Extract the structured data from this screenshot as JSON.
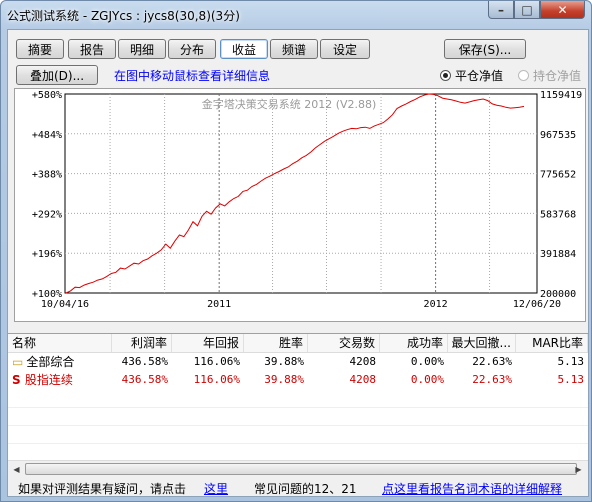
{
  "window": {
    "title": "公式测试系统 - ZGJYcs : jycs8(30,8)(3分)",
    "min_glyph": "–",
    "max_glyph": "□",
    "close_glyph": "✕"
  },
  "tabs": [
    {
      "label": "摘要"
    },
    {
      "label": "报告"
    },
    {
      "label": "明细"
    },
    {
      "label": "分布"
    },
    {
      "label": "收益",
      "selected": true
    },
    {
      "label": "频谱"
    },
    {
      "label": "设定"
    }
  ],
  "save_label": "保存(S)...",
  "overlay_label": "叠加(D)...",
  "hint": "在图中移动鼠标查看详细信息",
  "radio_close": "平仓净值",
  "radio_hold": "持仓净值",
  "chart_data": {
    "type": "line",
    "watermark": "金字塔决策交易系统 2012 (V2.88)",
    "left_ticks": [
      "+580%",
      "+484%",
      "+388%",
      "+292%",
      "+196%",
      "+100%"
    ],
    "right_ticks": [
      "1159419",
      "967535",
      "775652",
      "583768",
      "391884",
      "200000"
    ],
    "x_ticks": [
      "10/04/16",
      "2011",
      "2012",
      "12/06/20"
    ],
    "x_range": [
      "2010-04-16",
      "2012-06-20"
    ],
    "ylim": [
      100,
      580
    ],
    "line_color": "#e00000",
    "grid": true,
    "series": [
      {
        "values": [
          100,
          105,
          114,
          113,
          119,
          123,
          126,
          131,
          134,
          140,
          147,
          150,
          160,
          158,
          165,
          172,
          170,
          178,
          182,
          190,
          196,
          204,
          218,
          208,
          225,
          240,
          236,
          252,
          272,
          262,
          285,
          297,
          290,
          305,
          315,
          310,
          320,
          328,
          333,
          345,
          348,
          357,
          362,
          370,
          377,
          382,
          388,
          393,
          399,
          404,
          412,
          418,
          426,
          432,
          440,
          450,
          458,
          466,
          472,
          478,
          485,
          490,
          494,
          497,
          496,
          499,
          500,
          497,
          503,
          507,
          511,
          520,
          530,
          545,
          551,
          556,
          562,
          567,
          573,
          577,
          580,
          579,
          576,
          570,
          568,
          566,
          563,
          560,
          558,
          561,
          564,
          566,
          568,
          564,
          556,
          553,
          551,
          548,
          546,
          547,
          548,
          550
        ]
      }
    ]
  },
  "table": {
    "headers": [
      "名称",
      "利润率",
      "年回报",
      "胜率",
      "交易数",
      "成功率",
      "最大回撤...",
      "MAR比率"
    ],
    "rows": [
      {
        "name": "全部综合",
        "prefix": "",
        "color": "#000000",
        "values": [
          "436.58%",
          "116.06%",
          "39.88%",
          "4208",
          "0.00%",
          "22.63%",
          "5.13"
        ]
      },
      {
        "name": "股指连续",
        "prefix": "S",
        "color": "#d00000",
        "values": [
          "436.58%",
          "116.06%",
          "39.88%",
          "4208",
          "0.00%",
          "22.63%",
          "5.13"
        ]
      }
    ]
  },
  "footer": {
    "question": "如果对评测结果有疑问，请点击",
    "here": "这里",
    "faq": "常见问题的12、21",
    "glossary": "点这里看报告名词术语的详细解释"
  }
}
